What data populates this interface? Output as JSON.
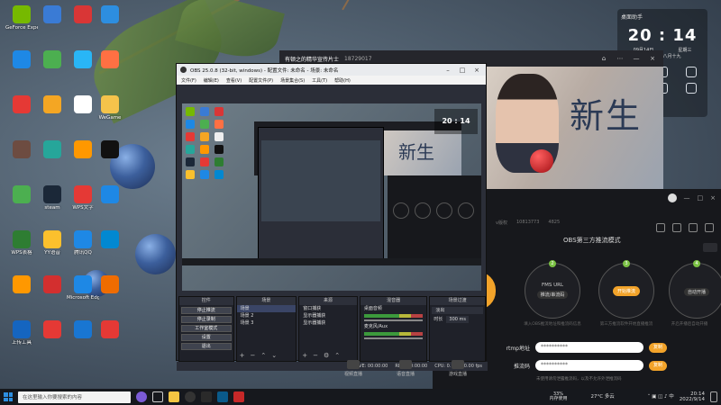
{
  "desktop": {
    "icons": [
      {
        "label": "GeForce Experience",
        "color": "#76b900"
      },
      {
        "label": "",
        "color": "#3a7bd5"
      },
      {
        "label": "",
        "color": "#d93636"
      },
      {
        "label": "",
        "color": "#2d8ee0"
      },
      {
        "label": "",
        "color": "#1e88e5"
      },
      {
        "label": "",
        "color": "#4caf50"
      },
      {
        "label": "",
        "color": "#29b6f6"
      },
      {
        "label": "",
        "color": "#ff7043"
      },
      {
        "label": "",
        "color": "#e53935"
      },
      {
        "label": "",
        "color": "#f4a623"
      },
      {
        "label": "",
        "color": "#ffffff"
      },
      {
        "label": "WeGame",
        "color": "#f5c34b"
      },
      {
        "label": "",
        "color": "#6d4c41"
      },
      {
        "label": "",
        "color": "#26a69a"
      },
      {
        "label": "",
        "color": "#ff9800"
      },
      {
        "label": "",
        "color": "#111111"
      },
      {
        "label": "",
        "color": "#4caf50"
      },
      {
        "label": "steam",
        "color": "#1b2838"
      },
      {
        "label": "WPS文字",
        "color": "#e53935"
      },
      {
        "label": "",
        "color": "#1e88e5"
      },
      {
        "label": "WPS表格",
        "color": "#2e7d32"
      },
      {
        "label": "YY语音",
        "color": "#fbc02d"
      },
      {
        "label": "腾讯QQ",
        "color": "#1e88e5"
      },
      {
        "label": "",
        "color": "#0288d1"
      },
      {
        "label": "",
        "color": "#ff9800"
      },
      {
        "label": "",
        "color": "#d32f2f"
      },
      {
        "label": "Microsoft Edge",
        "color": "#1e88e5"
      },
      {
        "label": "",
        "color": "#ef6c00"
      },
      {
        "label": "上传工具",
        "color": "#1565c0"
      },
      {
        "label": "",
        "color": "#e53935"
      },
      {
        "label": "",
        "color": "#1976d2"
      },
      {
        "label": "",
        "color": "#e53935"
      }
    ]
  },
  "clock_widget": {
    "caption": "桌面助手",
    "time": "20 : 14",
    "date": "09月14日",
    "weekday": "星期三",
    "lunar": "壬寅 • 虎八月十九",
    "tools": [
      "",
      "",
      "",
      "",
      "",
      ""
    ]
  },
  "player": {
    "title": "有顿之的精华宣传片士",
    "count": "18729017",
    "banner_text": "新生"
  },
  "obs": {
    "title": "OBS 25.0.8 (32-bit, windows) - 配置文件: 未命名 - 场景: 未命名",
    "menu": [
      "文件(F)",
      "编辑(E)",
      "查看(V)",
      "配置文件(P)",
      "场景集合(S)",
      "工具(T)",
      "帮助(H)"
    ],
    "docks": {
      "controls": {
        "header": "控件",
        "buttons": [
          "停止推流",
          "停止录制",
          "工作室模式",
          "设置",
          "退出"
        ]
      },
      "scenes": {
        "header": "场景",
        "items": [
          "场景",
          "场景 2",
          "场景 3"
        ]
      },
      "sources": {
        "header": "来源",
        "items": [
          "窗口捕获",
          "显示器捕获",
          "显示器捕获"
        ]
      },
      "mixer": {
        "header": "混音器",
        "items": [
          "桌面音频",
          "麦克风/Aux"
        ]
      },
      "transitions": {
        "header": "场景过渡",
        "selected": "淡出",
        "duration_label": "时长",
        "duration": "300 ms"
      }
    },
    "status": {
      "fps": "CPU: 0.7%, 30.00 fps",
      "rec": "REC: 00:00:00",
      "live": "LIVE: 00:00:00"
    }
  },
  "stream_app": {
    "heading": "OBS第三方推流模式",
    "meta": [
      "v版权",
      "10813773",
      "4825"
    ],
    "steps": [
      {
        "num": "1",
        "title": "",
        "sub": ""
      },
      {
        "num": "2",
        "title": "FMS URL",
        "sub": "推流/串流码"
      },
      {
        "num": "3",
        "title": "开始推流",
        "sub": ""
      },
      {
        "num": "4",
        "title": "自动开播",
        "sub": ""
      }
    ],
    "step_desc": [
      "",
      "填入OBS推流地址和推流码信息",
      "第三方推流软件开始直播推流",
      "开启开播后自动开播"
    ],
    "fields": [
      {
        "label": "rtmp地址",
        "value": "**********",
        "button": "复制"
      },
      {
        "label": "推流码",
        "value": "**********",
        "button": "复制"
      }
    ],
    "note": "未使用请勿泄露推流码，以及不允许外泄推流码"
  },
  "bottom_tools": [
    "视频直播",
    "语音直播",
    "游戏直播"
  ],
  "taskbar": {
    "search_placeholder": "在这里输入你要搜索的内容",
    "cpu_percent": "33%",
    "cpu_label": "内存使用",
    "weather": "27°C 多云",
    "time": "20:14",
    "date": "2022/9/14"
  },
  "colors": {
    "accent": "#f2a32a",
    "obs_bg": "#2b2e38",
    "step_green": "#7ac143"
  }
}
